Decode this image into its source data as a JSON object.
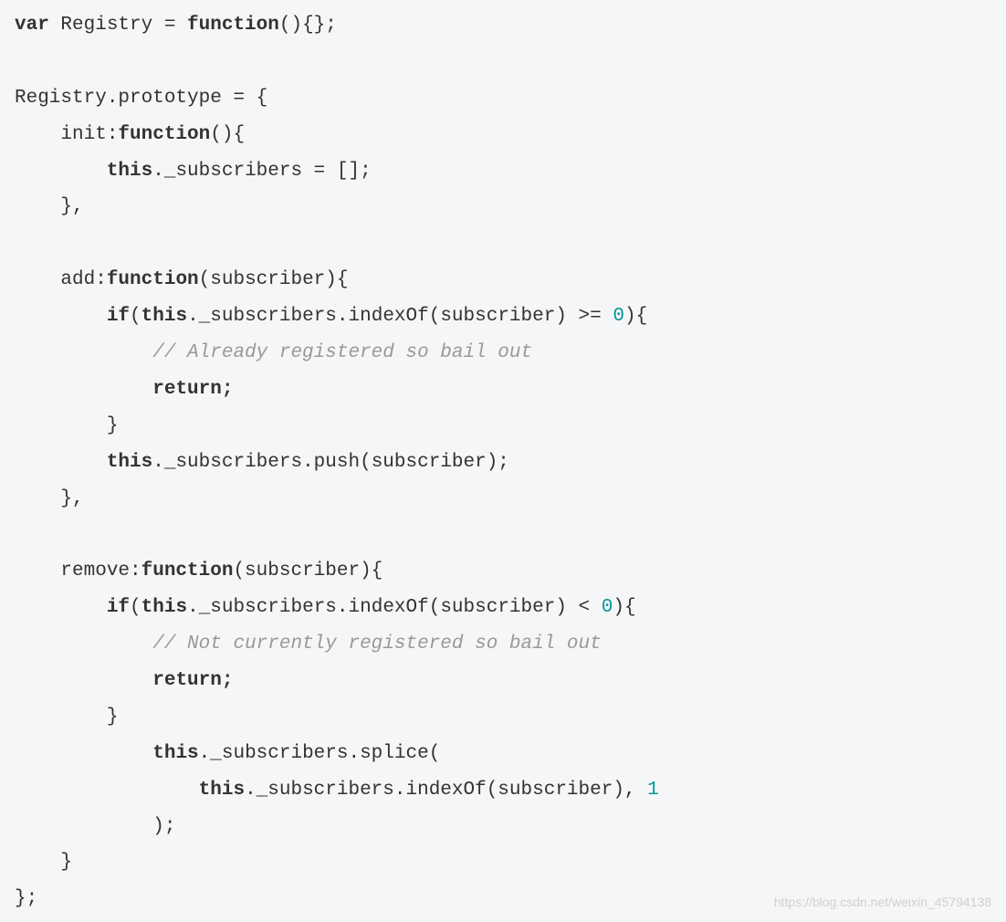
{
  "code": {
    "line1_var": "var",
    "line1_text": " Registry = ",
    "line1_func": "function",
    "line1_end": "(){};",
    "line3_text": "Registry.prototype = {",
    "line4_indent": "    init:",
    "line4_func": "function",
    "line4_end": "(){",
    "line5_indent": "        ",
    "line5_this": "this",
    "line5_end": "._subscribers = [];",
    "line6_text": "    },",
    "line8_indent": "    add:",
    "line8_func": "function",
    "line8_end": "(subscriber){",
    "line9_indent": "        ",
    "line9_if": "if",
    "line9_paren": "(",
    "line9_this": "this",
    "line9_mid": "._subscribers.indexOf(subscriber) >= ",
    "line9_num": "0",
    "line9_end": "){",
    "line10_indent": "            ",
    "line10_comment": "// Already registered so bail out",
    "line11_indent": "            ",
    "line11_return": "return;",
    "line12_text": "        }",
    "line13_indent": "        ",
    "line13_this": "this",
    "line13_end": "._subscribers.push(subscriber);",
    "line14_text": "    },",
    "line16_indent": "    remove:",
    "line16_func": "function",
    "line16_end": "(subscriber){",
    "line17_indent": "        ",
    "line17_if": "if",
    "line17_paren": "(",
    "line17_this": "this",
    "line17_mid": "._subscribers.indexOf(subscriber) < ",
    "line17_num": "0",
    "line17_end": "){",
    "line18_indent": "            ",
    "line18_comment": "// Not currently registered so bail out",
    "line19_indent": "            ",
    "line19_return": "return;",
    "line20_text": "        }",
    "line21_indent": "            ",
    "line21_this": "this",
    "line21_end": "._subscribers.splice(",
    "line22_indent": "                ",
    "line22_this": "this",
    "line22_mid": "._subscribers.indexOf(subscriber), ",
    "line22_num": "1",
    "line23_text": "            );",
    "line24_text": "    }",
    "line25_text": "};"
  },
  "watermark": "https://blog.csdn.net/weixin_45794138"
}
